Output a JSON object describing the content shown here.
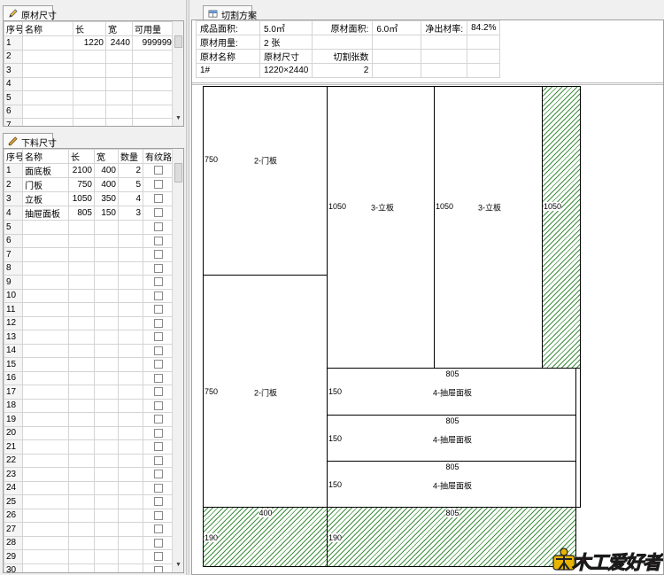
{
  "left_top": {
    "tab_label": "原材尺寸",
    "headers": [
      "序号",
      "名称",
      "长",
      "宽",
      "可用量"
    ],
    "rows": [
      {
        "no": "1",
        "name": "",
        "len": "1220",
        "wid": "2440",
        "qty": "999999"
      },
      {
        "no": "2",
        "name": "",
        "len": "",
        "wid": "",
        "qty": ""
      },
      {
        "no": "3",
        "name": "",
        "len": "",
        "wid": "",
        "qty": ""
      },
      {
        "no": "4",
        "name": "",
        "len": "",
        "wid": "",
        "qty": ""
      },
      {
        "no": "5",
        "name": "",
        "len": "",
        "wid": "",
        "qty": ""
      },
      {
        "no": "6",
        "name": "",
        "len": "",
        "wid": "",
        "qty": ""
      },
      {
        "no": "7",
        "name": "",
        "len": "",
        "wid": "",
        "qty": ""
      }
    ]
  },
  "left_bottom": {
    "tab_label": "下料尺寸",
    "headers": [
      "序号",
      "名称",
      "长",
      "宽",
      "数量",
      "有纹路"
    ],
    "rows": [
      {
        "no": "1",
        "name": "面底板",
        "len": "2100",
        "wid": "400",
        "qty": "2"
      },
      {
        "no": "2",
        "name": "门板",
        "len": "750",
        "wid": "400",
        "qty": "5"
      },
      {
        "no": "3",
        "name": "立板",
        "len": "1050",
        "wid": "350",
        "qty": "4"
      },
      {
        "no": "4",
        "name": "抽屉面板",
        "len": "805",
        "wid": "150",
        "qty": "3"
      },
      {
        "no": "5",
        "name": "",
        "len": "",
        "wid": "",
        "qty": ""
      },
      {
        "no": "6",
        "name": "",
        "len": "",
        "wid": "",
        "qty": ""
      },
      {
        "no": "7",
        "name": "",
        "len": "",
        "wid": "",
        "qty": ""
      },
      {
        "no": "8",
        "name": "",
        "len": "",
        "wid": "",
        "qty": ""
      },
      {
        "no": "9",
        "name": "",
        "len": "",
        "wid": "",
        "qty": ""
      },
      {
        "no": "10",
        "name": "",
        "len": "",
        "wid": "",
        "qty": ""
      },
      {
        "no": "11",
        "name": "",
        "len": "",
        "wid": "",
        "qty": ""
      },
      {
        "no": "12",
        "name": "",
        "len": "",
        "wid": "",
        "qty": ""
      },
      {
        "no": "13",
        "name": "",
        "len": "",
        "wid": "",
        "qty": ""
      },
      {
        "no": "14",
        "name": "",
        "len": "",
        "wid": "",
        "qty": ""
      },
      {
        "no": "15",
        "name": "",
        "len": "",
        "wid": "",
        "qty": ""
      },
      {
        "no": "16",
        "name": "",
        "len": "",
        "wid": "",
        "qty": ""
      },
      {
        "no": "17",
        "name": "",
        "len": "",
        "wid": "",
        "qty": ""
      },
      {
        "no": "18",
        "name": "",
        "len": "",
        "wid": "",
        "qty": ""
      },
      {
        "no": "19",
        "name": "",
        "len": "",
        "wid": "",
        "qty": ""
      },
      {
        "no": "20",
        "name": "",
        "len": "",
        "wid": "",
        "qty": ""
      },
      {
        "no": "21",
        "name": "",
        "len": "",
        "wid": "",
        "qty": ""
      },
      {
        "no": "22",
        "name": "",
        "len": "",
        "wid": "",
        "qty": ""
      },
      {
        "no": "23",
        "name": "",
        "len": "",
        "wid": "",
        "qty": ""
      },
      {
        "no": "24",
        "name": "",
        "len": "",
        "wid": "",
        "qty": ""
      },
      {
        "no": "25",
        "name": "",
        "len": "",
        "wid": "",
        "qty": ""
      },
      {
        "no": "26",
        "name": "",
        "len": "",
        "wid": "",
        "qty": ""
      },
      {
        "no": "27",
        "name": "",
        "len": "",
        "wid": "",
        "qty": ""
      },
      {
        "no": "28",
        "name": "",
        "len": "",
        "wid": "",
        "qty": ""
      },
      {
        "no": "29",
        "name": "",
        "len": "",
        "wid": "",
        "qty": ""
      },
      {
        "no": "30",
        "name": "",
        "len": "",
        "wid": "",
        "qty": ""
      }
    ]
  },
  "right": {
    "tab_label": "切割方案",
    "summary": {
      "finished_area_label": "成品面积:",
      "finished_area_value": "5.0㎡",
      "raw_area_label": "原材面积:",
      "raw_area_value": "6.0㎡",
      "yield_label": "净出材率:",
      "yield_value": "84.2%",
      "usage_label": "原材用量:",
      "usage_value": "2 张",
      "col_name": "原材名称",
      "col_size": "原材尺寸",
      "col_sheets": "切割张数",
      "row_name": "1#",
      "row_size": "1220×2440",
      "row_sheets": "2"
    }
  },
  "layout_labels": {
    "p1_left": "750",
    "p1_center": "2-门板",
    "p1_bottom": "400",
    "p2_left": "750",
    "p2_center": "2-门板",
    "p3_left": "1050",
    "p3_center": "3-立板",
    "p4_left": "1050",
    "p4_center": "3-立板",
    "w1_left": "1050",
    "d1_top": "805",
    "d1_left": "150",
    "d1_center": "4-抽屉面板",
    "d2_top": "805",
    "d2_left": "150",
    "d2_center": "4-抽屉面板",
    "d3_top": "805",
    "d3_left": "150",
    "d3_center": "4-抽屉面板",
    "w2_top": "400",
    "w2_left": "190",
    "w3_top": "805",
    "w3_left": "190"
  },
  "watermark": {
    "text": "木工爱好者"
  },
  "colors": {
    "waste_hatch": "#3f8f3f",
    "watermark": "#d10000",
    "accent": "#e8b400"
  }
}
